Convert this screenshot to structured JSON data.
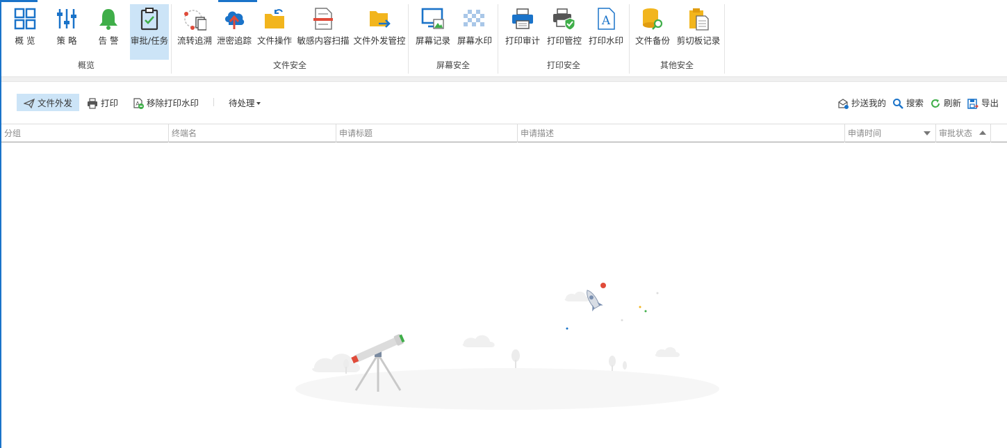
{
  "ribbon": {
    "groups": [
      {
        "label": "概览"
      },
      {
        "label": "文件安全"
      },
      {
        "label": "屏幕安全"
      },
      {
        "label": "打印安全"
      },
      {
        "label": "其他安全"
      }
    ],
    "buttons": [
      {
        "label": "概 览",
        "icon": "overview-grid-icon"
      },
      {
        "label": "策 略",
        "icon": "policy-sliders-icon"
      },
      {
        "label": "告 警",
        "icon": "alarm-bell-icon"
      },
      {
        "label": "审批/任务",
        "icon": "approval-clipboard-icon",
        "active": true
      },
      {
        "label": "流转追溯",
        "icon": "flow-trace-icon"
      },
      {
        "label": "泄密追踪",
        "icon": "leak-trace-cloud-icon"
      },
      {
        "label": "文件操作",
        "icon": "file-operation-folder-icon"
      },
      {
        "label": "敏感内容扫描",
        "icon": "sensitive-scan-icon"
      },
      {
        "label": "文件外发管控",
        "icon": "file-outbound-folder-icon"
      },
      {
        "label": "屏幕记录",
        "icon": "screen-record-icon"
      },
      {
        "label": "屏幕水印",
        "icon": "screen-watermark-icon"
      },
      {
        "label": "打印审计",
        "icon": "print-audit-icon"
      },
      {
        "label": "打印管控",
        "icon": "print-control-icon"
      },
      {
        "label": "打印水印",
        "icon": "print-watermark-icon"
      },
      {
        "label": "文件备份",
        "icon": "file-backup-icon"
      },
      {
        "label": "剪切板记录",
        "icon": "clipboard-record-icon"
      }
    ]
  },
  "toolbar": {
    "file_outbound": "文件外发",
    "print": "打印",
    "remove_print_watermark": "移除打印水印",
    "pending_filter": "待处理",
    "cc_me": "抄送我的",
    "search": "搜索",
    "refresh": "刷新",
    "export": "导出"
  },
  "table": {
    "columns": [
      "分组",
      "终端名",
      "申请标题",
      "申请描述",
      "申请时间",
      "审批状态"
    ]
  },
  "colors": {
    "accent": "#1a73c9",
    "active_bg": "#cce4f7"
  }
}
